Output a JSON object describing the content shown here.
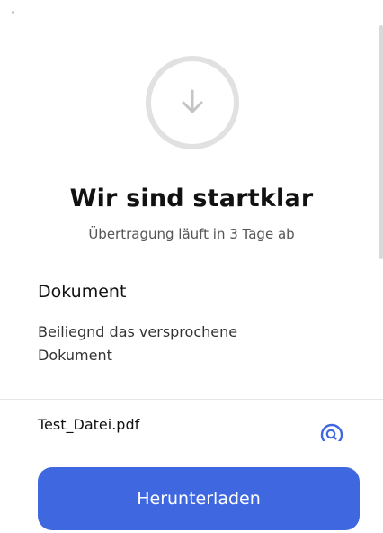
{
  "status": {
    "title": "Wir sind startklar",
    "subtitle": "Übertragung läuft in 3 Tage ab",
    "icon": "download-arrow-icon"
  },
  "message": {
    "heading": "Dokument",
    "body": "Beiliegnd das versprochene Dokument"
  },
  "files": [
    {
      "name": "Test_Datei.pdf",
      "action_icon": "preview-icon"
    }
  ],
  "actions": {
    "download_label": "Herunterladen"
  },
  "colors": {
    "accent": "#3f68e0",
    "circle_border": "#e1e1e1",
    "icon_gray": "#c4c4c4",
    "text_primary": "#111111",
    "text_secondary": "#555555"
  }
}
